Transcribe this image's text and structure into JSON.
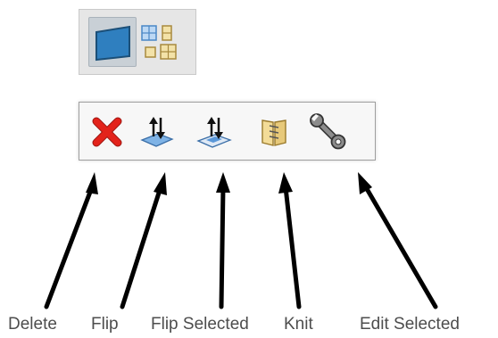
{
  "toolbar_top": {
    "buttons": [
      {
        "icon": "single-surface-icon",
        "state": "selected"
      },
      {
        "icon": "multi-view-grid-icon",
        "state": "normal"
      }
    ]
  },
  "toolbar_bottom": {
    "buttons": [
      {
        "icon": "delete-x-icon",
        "tooltip": "Delete",
        "color": "#e3231b"
      },
      {
        "icon": "flip-normals-icon",
        "tooltip": "Flip",
        "color": "#6a9fd4"
      },
      {
        "icon": "flip-selected-icon",
        "tooltip": "Flip Selected",
        "color": "#6a9fd4"
      },
      {
        "icon": "knit-icon",
        "tooltip": "Knit",
        "color": "#e7c97a"
      },
      {
        "icon": "wrench-icon",
        "tooltip": "Edit Selected",
        "color": "#555555"
      }
    ]
  },
  "callouts": {
    "delete": "Delete",
    "flip": "Flip",
    "flip_selected": "Flip Selected",
    "knit": "Knit",
    "edit_selected": "Edit Selected"
  }
}
